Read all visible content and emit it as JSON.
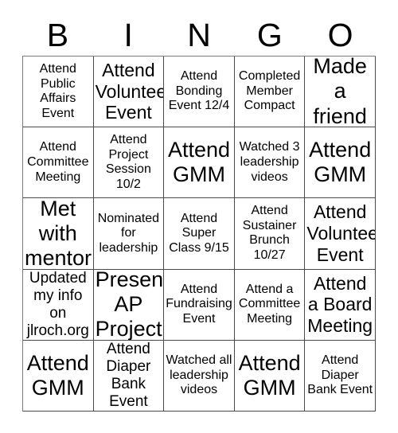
{
  "header": {
    "letters": [
      "B",
      "I",
      "N",
      "G",
      "O"
    ]
  },
  "grid": {
    "columns": 5,
    "rows": 5,
    "cells": [
      {
        "text": "Attend Public Affairs Event",
        "size": "s"
      },
      {
        "text": "Attend Volunteer Event",
        "size": "l"
      },
      {
        "text": "Attend Bonding Event 12/4",
        "size": "s"
      },
      {
        "text": "Completed Member Compact",
        "size": "s"
      },
      {
        "text": "Made a friend",
        "size": "xl"
      },
      {
        "text": "Attend Committee Meeting",
        "size": "s"
      },
      {
        "text": "Attend Project Session 10/2",
        "size": "s"
      },
      {
        "text": "Attend GMM",
        "size": "xl"
      },
      {
        "text": "Watched 3 leadership videos",
        "size": "s"
      },
      {
        "text": "Attend GMM",
        "size": "xl"
      },
      {
        "text": "Met with mentor",
        "size": "xl"
      },
      {
        "text": "Nominated for leadership",
        "size": "s"
      },
      {
        "text": "Attend Super Class 9/15",
        "size": "s"
      },
      {
        "text": "Attend Sustainer Brunch 10/27",
        "size": "s"
      },
      {
        "text": "Attend Volunteer Event",
        "size": "l"
      },
      {
        "text": "Updated my info on jlroch.org",
        "size": "m"
      },
      {
        "text": "Present AP Project",
        "size": "xl"
      },
      {
        "text": "Attend Fundraising Event",
        "size": "s"
      },
      {
        "text": "Attend a Committee Meeting",
        "size": "s"
      },
      {
        "text": "Attend a Board Meeting",
        "size": "l"
      },
      {
        "text": "Attend GMM",
        "size": "xl"
      },
      {
        "text": "Attend Diaper Bank Event",
        "size": "m"
      },
      {
        "text": "Watched all leadership videos",
        "size": "s"
      },
      {
        "text": "Attend GMM",
        "size": "xl"
      },
      {
        "text": "Attend Diaper Bank Event",
        "size": "s"
      }
    ]
  },
  "colors": {
    "background": "#ffffff",
    "text": "#000000",
    "border": "#4a4a4a"
  }
}
